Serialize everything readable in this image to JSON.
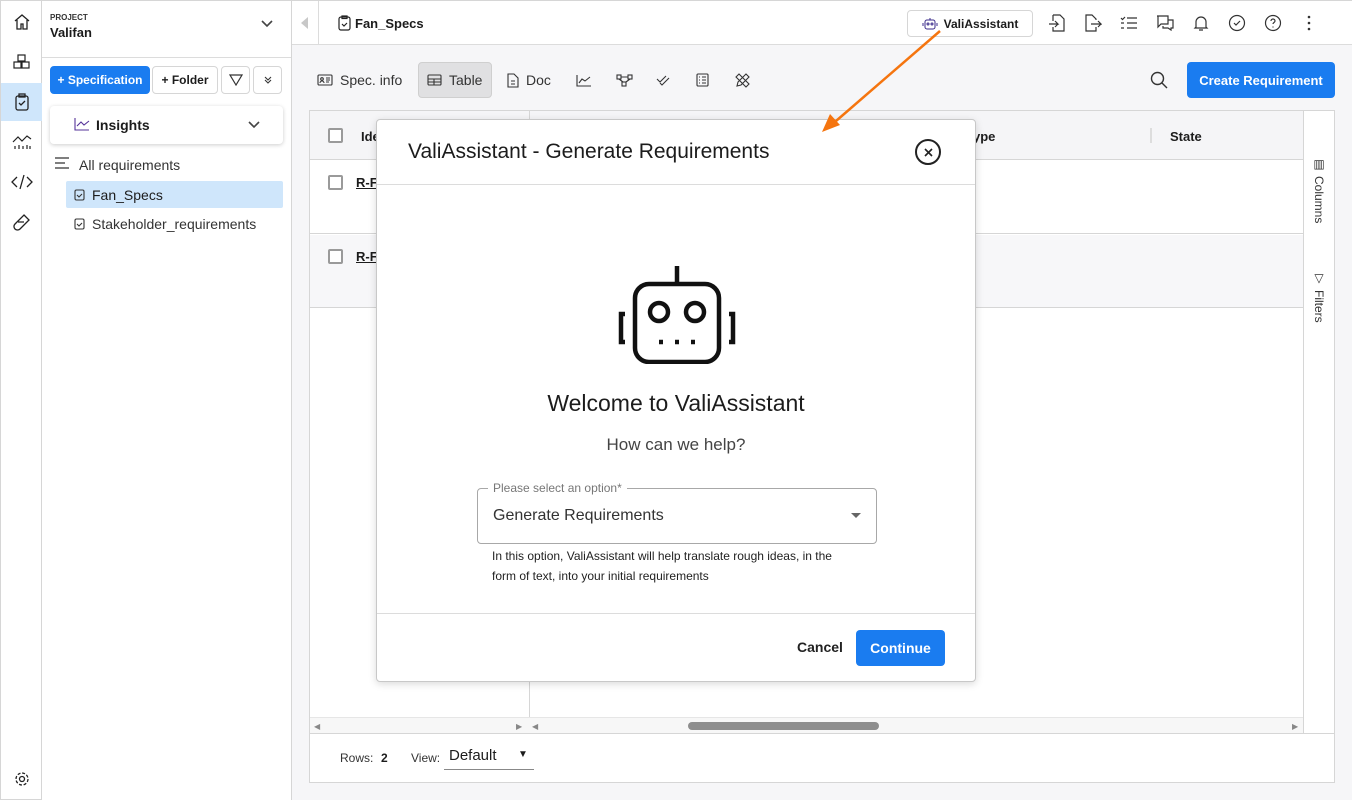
{
  "project": {
    "label": "PROJECT",
    "name": "Valifan"
  },
  "sidebar": {
    "add_spec": "+ Specification",
    "add_folder": "+ Folder",
    "insights": "Insights",
    "all_requirements": "All requirements",
    "items": [
      {
        "label": "Fan_Specs",
        "active": true
      },
      {
        "label": "Stakeholder_requirements"
      }
    ]
  },
  "topbar": {
    "title": "Fan_Specs",
    "assistant_button": "ValiAssistant"
  },
  "toolbar": {
    "spec_info": "Spec. info",
    "table": "Table",
    "doc": "Doc",
    "create": "Create Requirement"
  },
  "table": {
    "columns": [
      "Ide",
      "Type",
      "State"
    ],
    "rows": [
      {
        "id": "R-F"
      },
      {
        "id": "R-F"
      }
    ],
    "side_columns": "Columns",
    "side_filters": "Filters"
  },
  "footer": {
    "rows_label": "Rows:",
    "rows_value": "2",
    "view_label": "View:",
    "view_value": "Default"
  },
  "modal": {
    "title": "ValiAssistant - Generate Requirements",
    "welcome": "Welcome to ValiAssistant",
    "subtitle": "How can we help?",
    "select_label": "Please select an option*",
    "select_value": "Generate Requirements",
    "help": "In this option, ValiAssistant will help translate rough ideas, in the form of text, into your initial requirements",
    "cancel": "Cancel",
    "continue": "Continue"
  },
  "colors": {
    "accent": "#1a7cf0",
    "annotation_arrow": "#f5750f",
    "active_bg": "#cfe6fb"
  }
}
